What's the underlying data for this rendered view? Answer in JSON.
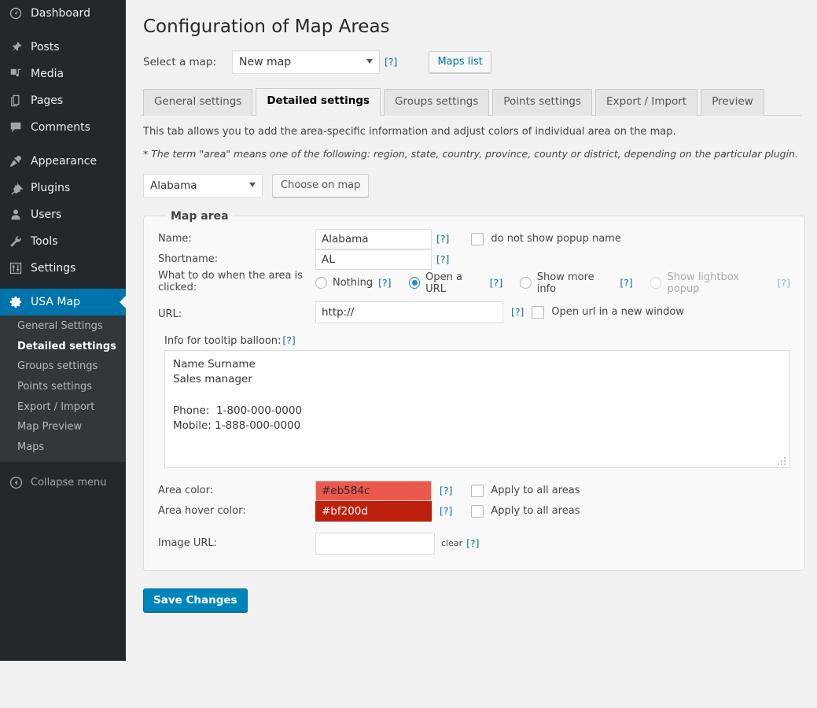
{
  "sidebar": {
    "items": [
      {
        "label": "Dashboard",
        "icon": "dashboard-icon",
        "name": "dashboard"
      },
      {
        "label": "Posts",
        "icon": "pin-icon",
        "name": "posts"
      },
      {
        "label": "Media",
        "icon": "media-icon",
        "name": "media"
      },
      {
        "label": "Pages",
        "icon": "page-icon",
        "name": "pages"
      },
      {
        "label": "Comments",
        "icon": "comment-icon",
        "name": "comments"
      },
      {
        "label": "Appearance",
        "icon": "brush-icon",
        "name": "appearance"
      },
      {
        "label": "Plugins",
        "icon": "plug-icon",
        "name": "plugins"
      },
      {
        "label": "Users",
        "icon": "user-icon",
        "name": "users"
      },
      {
        "label": "Tools",
        "icon": "wrench-icon",
        "name": "tools"
      },
      {
        "label": "Settings",
        "icon": "sliders-icon",
        "name": "settings"
      }
    ],
    "current": {
      "label": "USA Map",
      "icon": "gear-icon",
      "name": "usa-map"
    },
    "submenu": [
      {
        "label": "General Settings",
        "current": false
      },
      {
        "label": "Detailed settings",
        "current": true
      },
      {
        "label": "Groups settings",
        "current": false
      },
      {
        "label": "Points settings",
        "current": false
      },
      {
        "label": "Export / Import",
        "current": false
      },
      {
        "label": "Map Preview",
        "current": false
      },
      {
        "label": "Maps",
        "current": false
      }
    ],
    "collapse_label": "Collapse menu",
    "active_color": "#0073aa"
  },
  "header": {
    "title": "Configuration of Map Areas",
    "select_map_label": "Select a map:",
    "map_value": "New map",
    "map_options": [
      "New map"
    ],
    "help": "[?]",
    "maps_list_button": "Maps list"
  },
  "tabs": [
    {
      "label": "General settings",
      "active": false
    },
    {
      "label": "Detailed settings",
      "active": true
    },
    {
      "label": "Groups settings",
      "active": false
    },
    {
      "label": "Points settings",
      "active": false
    },
    {
      "label": "Export / Import",
      "active": false
    },
    {
      "label": "Preview",
      "active": false
    }
  ],
  "intro": {
    "line1": "This tab allows you to add the area-specific information and adjust colors of individual area on the map.",
    "line2": "* The term \"area\" means one of the following: region, state, country, province, county or district, depending on the particular plugin."
  },
  "area_picker": {
    "selected": "Alabama",
    "options": [
      "Alabama"
    ],
    "choose_on_map_button": "Choose on map"
  },
  "map_area": {
    "legend": "Map area",
    "name_label": "Name:",
    "name_value": "Alabama",
    "name_help": "[?]",
    "no_popup_name_label": "do not show popup name",
    "no_popup_name_checked": false,
    "shortname_label": "Shortname:",
    "shortname_value": "AL",
    "shortname_help": "[?]",
    "click_action_label": "What to do when the area is clicked:",
    "click_action_label_l1": "What to do when the area is",
    "click_action_label_l2": "clicked:",
    "click_options": [
      {
        "label": "Nothing",
        "help": "[?]",
        "checked": false,
        "disabled": false
      },
      {
        "label": "Open a URL",
        "help": "[?]",
        "checked": true,
        "disabled": false
      },
      {
        "label": "Show more info",
        "help": "[?]",
        "checked": false,
        "disabled": false
      },
      {
        "label": "Show lightbox popup",
        "help": "[?]",
        "checked": false,
        "disabled": true
      }
    ],
    "url_label": "URL:",
    "url_value": "http://",
    "url_help": "[?]",
    "url_newwindow_label": "Open url in a new window",
    "url_newwindow_checked": false,
    "tooltip_label": "Info for tooltip balloon:",
    "tooltip_help": "[?]",
    "tooltip_value": "Name Surname\nSales manager\n\nPhone:  1-800-000-0000\nMobile: 1-888-000-0000",
    "area_color_label": "Area color:",
    "area_color_value": "#eb584c",
    "area_color_help": "[?]",
    "area_color_apply_label": "Apply to all areas",
    "area_color_apply_checked": false,
    "hover_color_label": "Area hover color:",
    "hover_color_value": "#bf200d",
    "hover_color_help": "[?]",
    "hover_color_apply_label": "Apply to all areas",
    "hover_color_apply_checked": false,
    "image_url_label": "Image URL:",
    "image_url_value": "",
    "image_url_clear": "clear",
    "image_url_help": "[?]"
  },
  "footer": {
    "save_button": "Save Changes"
  }
}
